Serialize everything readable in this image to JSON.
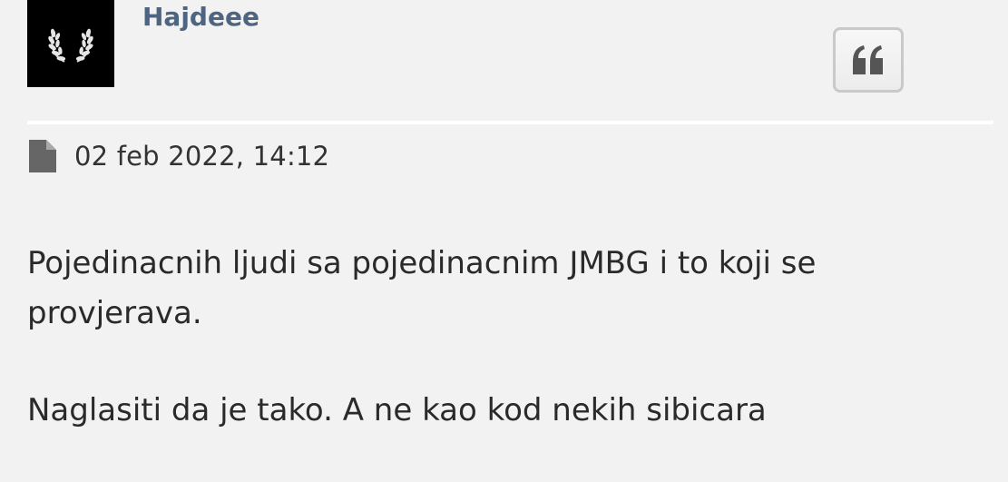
{
  "post": {
    "author": {
      "username": "Hajdeee",
      "avatar_icon": "laurel-wreath-icon"
    },
    "quote_button": {
      "icon": "quote-icon"
    },
    "timestamp": {
      "icon": "file-icon",
      "text": "02 feb 2022, 14:12"
    },
    "body": {
      "line1": "Pojedinacnih ljudi sa pojedinacnim JMBG i to koji se provjerava.",
      "line2": "Naglasiti da je tako. A ne kao kod nekih sibicara"
    }
  },
  "colors": {
    "background": "#f2f2f2",
    "username": "#4d6580",
    "text": "#2a2a2a",
    "icon": "#555555"
  }
}
